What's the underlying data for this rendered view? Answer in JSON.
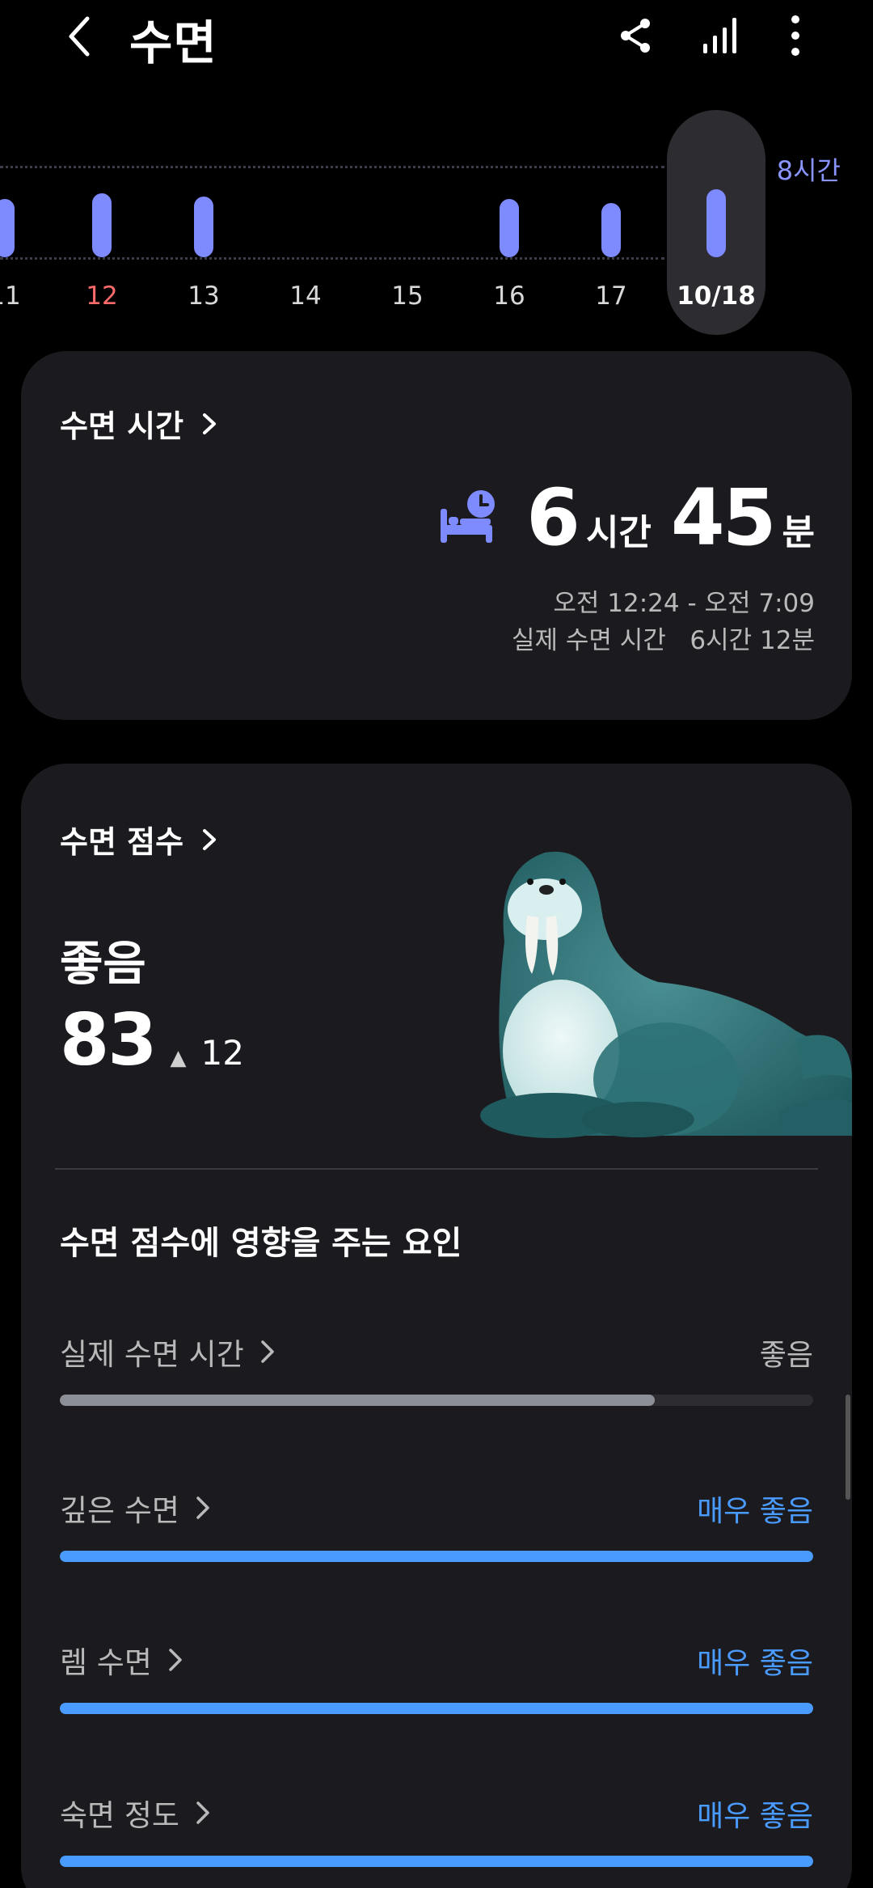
{
  "header": {
    "title": "수면",
    "back_icon": "chevron-left-icon",
    "actions": [
      "share-icon",
      "signal-icon",
      "more-vert-icon"
    ]
  },
  "sleep_chart": {
    "goal_label": "8시간",
    "selected_label": "10/18",
    "days": [
      {
        "label": "11",
        "sunday": false,
        "level": 0.72
      },
      {
        "label": "12",
        "sunday": true,
        "level": 0.79
      },
      {
        "label": "13",
        "sunday": false,
        "level": 0.75
      },
      {
        "label": "14",
        "sunday": false,
        "level": 0
      },
      {
        "label": "15",
        "sunday": false,
        "level": 0
      },
      {
        "label": "16",
        "sunday": false,
        "level": 0.72
      },
      {
        "label": "17",
        "sunday": false,
        "level": 0.67
      },
      {
        "label": "10/18",
        "sunday": false,
        "level": 0.84
      }
    ]
  },
  "sleep_time_card": {
    "title": "수면 시간",
    "hours": "6",
    "hours_unit": "시간",
    "minutes": "45",
    "minutes_unit": "분",
    "range": "오전 12:24 - 오전 7:09",
    "actual_sleep": "실제 수면 시간   6시간 12분",
    "icon": "bed-clock-icon"
  },
  "sleep_score_card": {
    "title": "수면 점수",
    "rating": "좋음",
    "score": "83",
    "delta_icon": "triangle-up-icon",
    "delta": "12",
    "factors_title": "수면 점수에 영향을 주는 요인",
    "factors": [
      {
        "label": "실제 수면 시간",
        "rating": "좋음",
        "level": 0.79,
        "great": false
      },
      {
        "label": "깊은 수면",
        "rating": "매우 좋음",
        "level": 1.0,
        "great": true
      },
      {
        "label": "렘 수면",
        "rating": "매우 좋음",
        "level": 1.0,
        "great": true
      },
      {
        "label": "숙면 정도",
        "rating": "매우 좋음",
        "level": 1.0,
        "great": true
      }
    ]
  },
  "colors": {
    "accent": "#7e8bff",
    "great": "#4a9bff",
    "sunday": "#ff6b6b",
    "card": "#1b1b1f"
  }
}
